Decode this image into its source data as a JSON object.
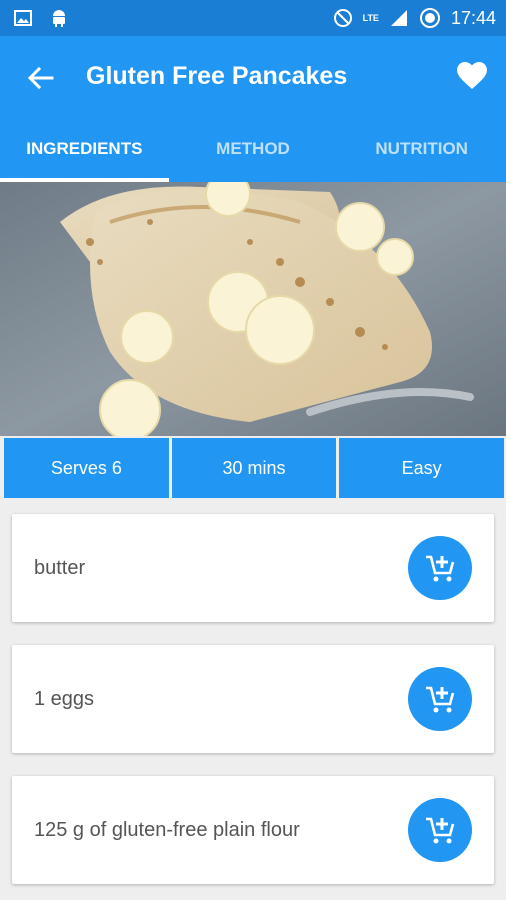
{
  "status_bar": {
    "time": "17:44",
    "network_label": "LTE",
    "icons": [
      "image-icon",
      "android-icon",
      "do-not-disturb-icon",
      "signal-icon",
      "alarm-icon"
    ]
  },
  "app_bar": {
    "title": "Gluten Free Pancakes",
    "back_icon": "arrow-back-icon",
    "favorite_icon": "heart-icon"
  },
  "tabs": [
    {
      "label": "INGREDIENTS",
      "active": true
    },
    {
      "label": "METHOD",
      "active": false
    },
    {
      "label": "NUTRITION",
      "active": false
    }
  ],
  "hero_image": {
    "subject": "folded pancakes with banana slices and honey"
  },
  "recipe_info": {
    "serves": "Serves 6",
    "time": "30 mins",
    "difficulty": "Easy"
  },
  "ingredients": [
    {
      "text": "butter",
      "action_icon": "add-to-cart-icon"
    },
    {
      "text": "1 eggs",
      "action_icon": "add-to-cart-icon"
    },
    {
      "text": "125 g of gluten-free plain flour",
      "action_icon": "add-to-cart-icon"
    }
  ],
  "colors": {
    "primary": "#2196f3",
    "primary_dark": "#1a7fd4",
    "background": "#eeeeee",
    "card": "#ffffff"
  }
}
